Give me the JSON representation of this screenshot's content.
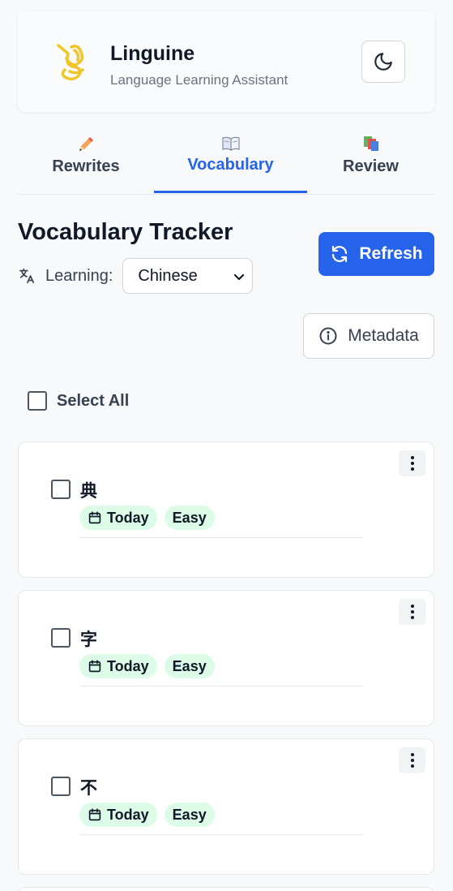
{
  "app": {
    "title": "Linguine",
    "subtitle": "Language Learning Assistant"
  },
  "tabs": [
    {
      "label": "Rewrites",
      "icon": "pencil-icon"
    },
    {
      "label": "Vocabulary",
      "icon": "book-icon",
      "active": true
    },
    {
      "label": "Review",
      "icon": "cards-icon"
    }
  ],
  "tracker": {
    "title": "Vocabulary Tracker",
    "learning_label": "Learning:",
    "language": "Chinese",
    "refresh_label": "Refresh",
    "metadata_label": "Metadata",
    "select_all_label": "Select All"
  },
  "cards": [
    {
      "word": "典",
      "date": "Today",
      "difficulty": "Easy"
    },
    {
      "word": "字",
      "date": "Today",
      "difficulty": "Easy"
    },
    {
      "word": "不",
      "date": "Today",
      "difficulty": "Easy"
    }
  ],
  "colors": {
    "accent": "#2563eb",
    "badge_bg": "#dcfce7",
    "logo": "#f0c419"
  }
}
